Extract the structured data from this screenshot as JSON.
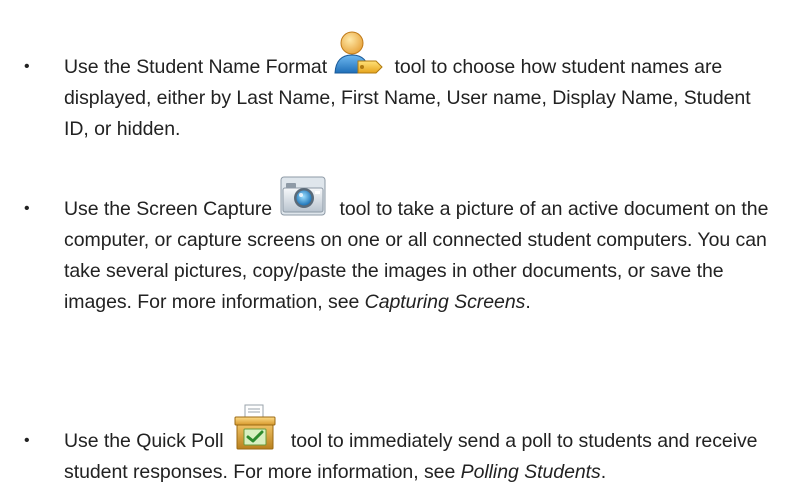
{
  "bullets": [
    {
      "before": "Use the Student Name Format",
      "after": " tool to choose how student names are displayed, either by Last Name, First Name, User name, Display Name, Student ID, or hidden.",
      "icon": "student-name-format-icon"
    },
    {
      "before": "Use the Screen Capture",
      "after": " tool to take a picture of an active document on the computer, or capture screens on one or all connected student computers. You can take several pictures, copy/paste the images in other documents, or save the images. For more information, see ",
      "link": "Capturing Screens",
      "end": ".",
      "icon": "camera-icon"
    },
    {
      "before": "Use the Quick Poll",
      "after": " tool to immediately send a poll to students and receive student responses. For more information, see ",
      "link": "Polling Students",
      "end": ".",
      "icon": "quick-poll-icon"
    }
  ],
  "bullet_glyph": "•"
}
